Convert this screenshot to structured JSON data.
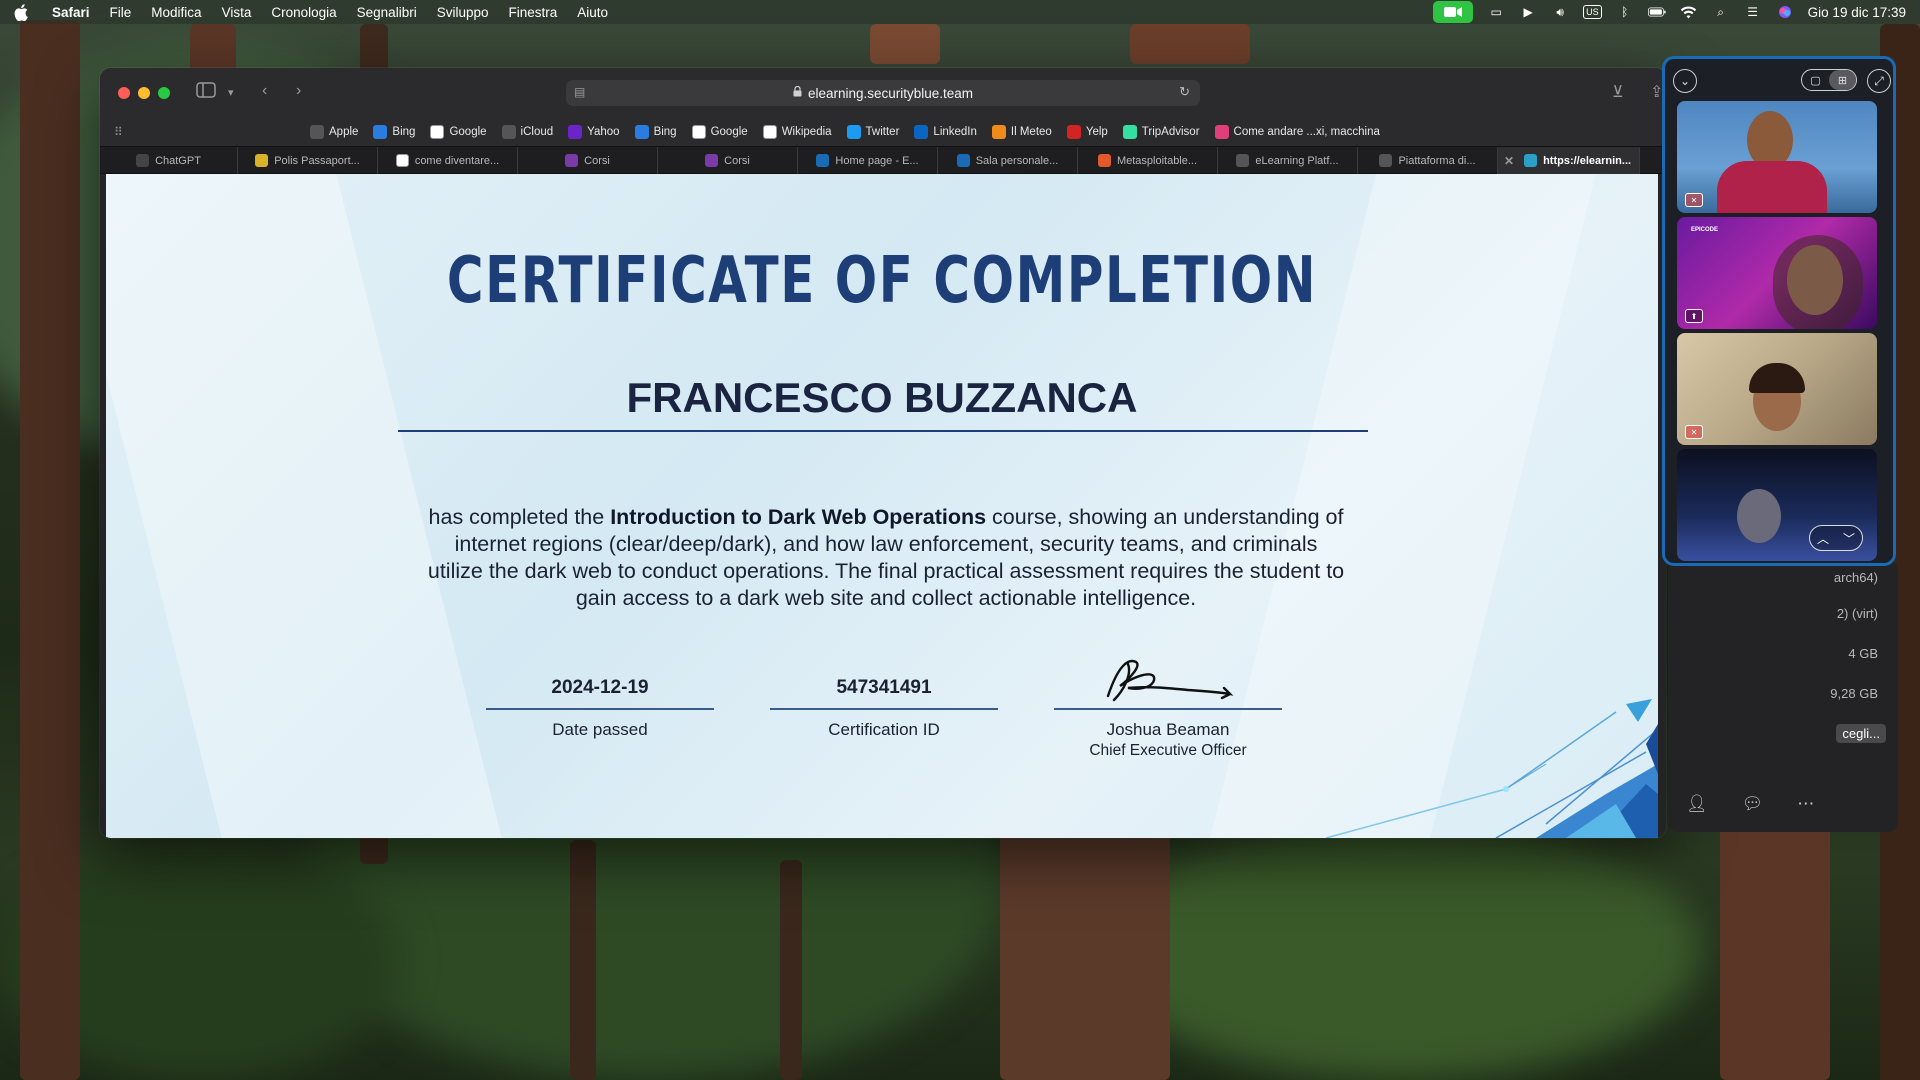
{
  "menubar": {
    "app": "Safari",
    "items": [
      "File",
      "Modifica",
      "Vista",
      "Cronologia",
      "Segnalibri",
      "Sviluppo",
      "Finestra",
      "Aiuto"
    ],
    "input_source": "US",
    "datetime": "Gio 19 dic  17:39"
  },
  "browser": {
    "url": "elearning.securityblue.team",
    "bookmarks": [
      {
        "label": "Apple",
        "icon": "apple-icon",
        "color": "#555555"
      },
      {
        "label": "Bing",
        "icon": "bing-icon",
        "color": "#2a7ce0"
      },
      {
        "label": "Google",
        "icon": "google-icon",
        "color": "#ffffff"
      },
      {
        "label": "iCloud",
        "icon": "apple-icon",
        "color": "#555555"
      },
      {
        "label": "Yahoo",
        "icon": "yahoo-icon",
        "color": "#6a24c8"
      },
      {
        "label": "Bing",
        "icon": "bing-icon",
        "color": "#2a7ce0"
      },
      {
        "label": "Google",
        "icon": "google-icon",
        "color": "#ffffff"
      },
      {
        "label": "Wikipedia",
        "icon": "wikipedia-icon",
        "color": "#ffffff"
      },
      {
        "label": "Twitter",
        "icon": "twitter-icon",
        "color": "#1d9bf0"
      },
      {
        "label": "LinkedIn",
        "icon": "linkedin-icon",
        "color": "#0a66c2"
      },
      {
        "label": "Il Meteo",
        "icon": "meteo-icon",
        "color": "#f08a1c"
      },
      {
        "label": "Yelp",
        "icon": "yelp-icon",
        "color": "#d32323"
      },
      {
        "label": "TripAdvisor",
        "icon": "tripadvisor-icon",
        "color": "#34e0a1"
      },
      {
        "label": "Come andare ...xi, macchina",
        "icon": "maps-icon",
        "color": "#e0407a"
      }
    ],
    "tabs": [
      {
        "label": "ChatGPT",
        "icon": "chatgpt-icon",
        "color": "#444444"
      },
      {
        "label": "Polis Passaport...",
        "icon": "polis-icon",
        "color": "#d9b22a"
      },
      {
        "label": "come diventare...",
        "icon": "google-icon",
        "color": "#ffffff"
      },
      {
        "label": "Corsi",
        "icon": "corsi-icon",
        "color": "#7a3aa8"
      },
      {
        "label": "Corsi",
        "icon": "corsi-icon",
        "color": "#7a3aa8"
      },
      {
        "label": "Home page - E...",
        "icon": "epicode-icon",
        "color": "#1a6bb5"
      },
      {
        "label": "Sala personale...",
        "icon": "epicode-icon",
        "color": "#1a6bb5"
      },
      {
        "label": "Metasploitable...",
        "icon": "metasploit-icon",
        "color": "#e05a2a"
      },
      {
        "label": "eLearning Platf...",
        "icon": "elearning-icon",
        "color": "#555555"
      },
      {
        "label": "Piattaforma di...",
        "icon": "elearning-icon",
        "color": "#555555"
      },
      {
        "label": "https://elearnin...",
        "icon": "shield-icon",
        "color": "#2aa0c8",
        "active": true
      }
    ]
  },
  "certificate": {
    "title": "CERTIFICATE OF COMPLETION",
    "recipient": "FRANCESCO BUZZANCA",
    "desc_prefix": "has completed the ",
    "course": "Introduction to Dark Web Operations",
    "desc_suffix": " course, showing an understanding of internet regions (clear/deep/dark), and how law enforcement, security teams, and criminals utilize the dark web to conduct operations. The final practical assessment requires the student to gain access to a dark web site and collect actionable intelligence.",
    "date_value": "2024-12-19",
    "date_label": "Date passed",
    "cert_id_value": "547341491",
    "cert_id_label": "Certification ID",
    "signer_name": "Joshua Beaman",
    "signer_title": "Chief Executive Officer",
    "colors": {
      "title": "#1e3e78",
      "text": "#1b2133"
    }
  },
  "facetime": {
    "background_rows": [
      "arch64)",
      "2) (virt)",
      "4 GB",
      "9,28 GB"
    ],
    "background_button": "cegli...",
    "participants": 4,
    "tile2_caption": "EPICODE"
  }
}
